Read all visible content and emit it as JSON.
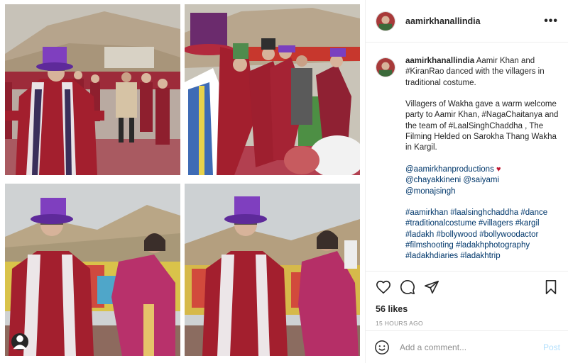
{
  "post": {
    "username": "aamirkhanallindia",
    "more_icon": "more-horizontal-icon",
    "media_alts": [
      "Aamir Khan in purple top hat and red traditional costume dancing with villagers",
      "Dancers in traditional costumes with purple hats and fur",
      "Aamir Khan in purple top hat dancing outdoors against mountains",
      "Aamir Khan dancing with a villager woman in red costume"
    ]
  },
  "caption": {
    "username": "aamirkhanallindia",
    "line1": "Aamir Khan and #KiranRao danced with the villagers in traditional costume.",
    "line2": "Villagers of Wakha gave a warm welcome party to Aamir Khan, #NagaChaitanya and the team of #LaalSinghChaddha , The Filming Helded on Sarokha Thang Wakha in Kargil.",
    "mention1": "@aamirkhanproductions",
    "heart": "♥",
    "mention2": "@chayakkineni",
    "mention3": "@saiyami",
    "mention4": "@monajsingh",
    "hashtags": "#aamirkhan #laalsinghchaddha #dance #traditionalcostume #villagers #kargil #ladakh #bollywood #bollywoodactor #filmshooting #ladakhphotography #ladakhdiaries #ladakhtrip"
  },
  "actions": {
    "like_icon": "heart-icon",
    "comment_icon": "comment-icon",
    "share_icon": "paper-plane-icon",
    "save_icon": "bookmark-icon"
  },
  "likes": "56 likes",
  "timestamp": "15 HOURS AGO",
  "comment_box": {
    "placeholder": "Add a comment...",
    "post_label": "Post"
  },
  "colors": {
    "link": "#00376b",
    "post_disabled": "#b2dffc",
    "divider": "#efefef",
    "muted": "#8e8e8e"
  }
}
